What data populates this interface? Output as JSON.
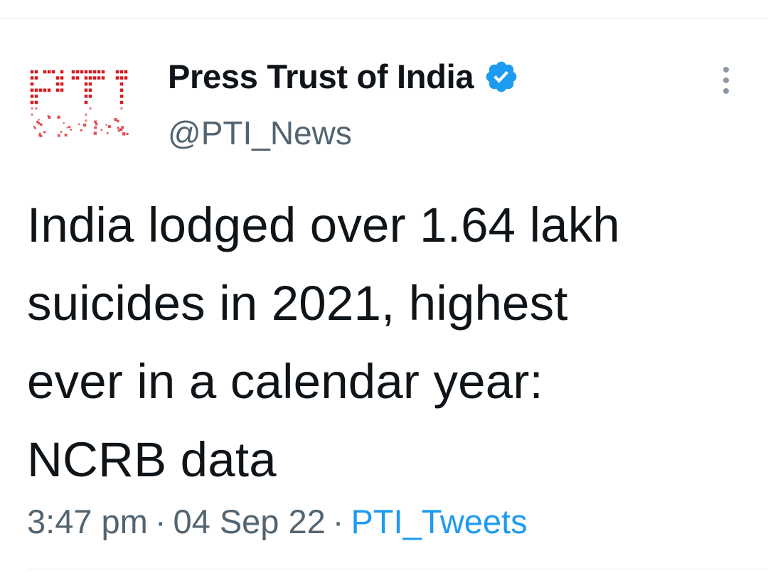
{
  "tweet": {
    "author": {
      "display_name": "Press Trust of India",
      "handle": "@PTI_News",
      "verified": true,
      "avatar_icon": "pti-logo-icon",
      "avatar_logo_text": "PTI",
      "avatar_color": "#d71920"
    },
    "text_lines": [
      "India lodged over 1.64 lakh",
      "suicides in 2021, highest",
      "ever in a calendar year:",
      "NCRB data"
    ],
    "time": "3:47 pm",
    "date": "04 Sep 22",
    "separator": "·",
    "source": "PTI_Tweets",
    "source_color": "#1d9bf0",
    "verified_color": "#1d9bf0",
    "more_icon": "more-vertical-icon"
  }
}
